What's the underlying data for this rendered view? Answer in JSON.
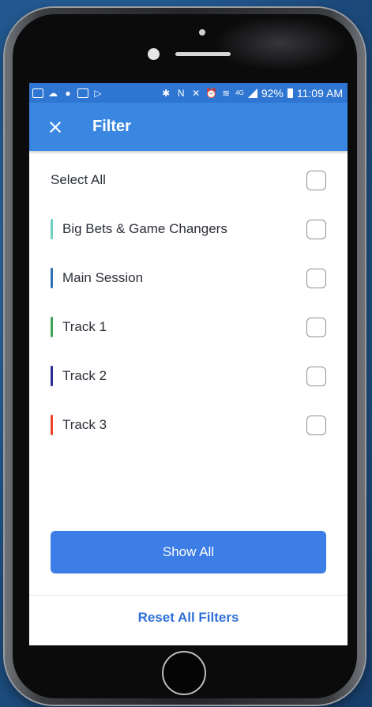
{
  "status_bar": {
    "battery_percent": "92%",
    "time": "11:09 AM",
    "network": "4G",
    "left_icons": [
      "mail-icon",
      "weather-icon",
      "cloud-icon",
      "image-icon",
      "play-store-icon"
    ],
    "right_icons": [
      "bluetooth-icon",
      "nfc-icon",
      "mute-icon",
      "alarm-icon",
      "wifi-icon",
      "signal-icon",
      "battery-icon"
    ]
  },
  "app_bar": {
    "title": "Filter",
    "close_icon": "close-icon"
  },
  "filters": [
    {
      "label": "Select All",
      "color": null,
      "checked": false
    },
    {
      "label": "Big Bets & Game Changers",
      "color": "#6ccfc0",
      "checked": false
    },
    {
      "label": "Main Session",
      "color": "#2f6fb6",
      "checked": false
    },
    {
      "label": "Track 1",
      "color": "#3fa356",
      "checked": false
    },
    {
      "label": "Track 2",
      "color": "#2a2d97",
      "checked": false
    },
    {
      "label": "Track 3",
      "color": "#e8452f",
      "checked": false
    }
  ],
  "actions": {
    "show_all_label": "Show All",
    "reset_label": "Reset All Filters"
  },
  "colors": {
    "status_bar": "#2f75d2",
    "app_bar": "#3a87e2",
    "primary_button": "#3c7de6",
    "link": "#2f70d8"
  }
}
